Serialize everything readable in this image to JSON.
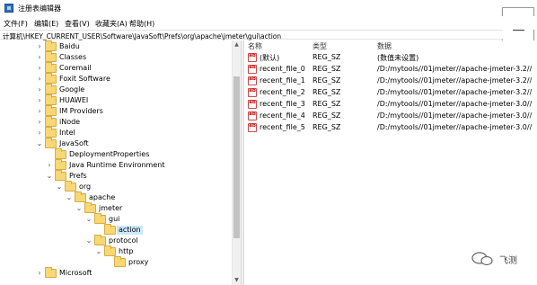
{
  "window": {
    "title": "注册表编辑器"
  },
  "menu": [
    "文件(F)",
    "编辑(E)",
    "查看(V)",
    "收藏夹(A)",
    "帮助(H)"
  ],
  "address": "计算机\\HKEY_CURRENT_USER\\Software\\JavaSoft\\Prefs\\org\\apache\\jmeter\\gui\\action",
  "tree": [
    {
      "label": "Baidu",
      "depth": 0,
      "state": "collapsed"
    },
    {
      "label": "Classes",
      "depth": 0,
      "state": "collapsed"
    },
    {
      "label": "Coremail",
      "depth": 0,
      "state": "collapsed"
    },
    {
      "label": "Foxit Software",
      "depth": 0,
      "state": "collapsed"
    },
    {
      "label": "Google",
      "depth": 0,
      "state": "collapsed"
    },
    {
      "label": "HUAWEI",
      "depth": 0,
      "state": "collapsed"
    },
    {
      "label": "IM Providers",
      "depth": 0,
      "state": "collapsed"
    },
    {
      "label": "iNode",
      "depth": 0,
      "state": "collapsed"
    },
    {
      "label": "Intel",
      "depth": 0,
      "state": "collapsed"
    },
    {
      "label": "JavaSoft",
      "depth": 0,
      "state": "expanded"
    },
    {
      "label": "DeploymentProperties",
      "depth": 1,
      "state": "none"
    },
    {
      "label": "Java Runtime Environment",
      "depth": 1,
      "state": "collapsed"
    },
    {
      "label": "Prefs",
      "depth": 1,
      "state": "expanded"
    },
    {
      "label": "org",
      "depth": 2,
      "state": "expanded"
    },
    {
      "label": "apache",
      "depth": 3,
      "state": "expanded"
    },
    {
      "label": "jmeter",
      "depth": 4,
      "state": "expanded"
    },
    {
      "label": "gui",
      "depth": 5,
      "state": "expanded"
    },
    {
      "label": "action",
      "depth": 6,
      "state": "none",
      "selected": true
    },
    {
      "label": "protocol",
      "depth": 5,
      "state": "expanded"
    },
    {
      "label": "http",
      "depth": 6,
      "state": "expanded"
    },
    {
      "label": "proxy",
      "depth": 7,
      "state": "none"
    },
    {
      "label": "Microsoft",
      "depth": 0,
      "state": "collapsed"
    }
  ],
  "list": {
    "columns": [
      "名称",
      "类型",
      "数据"
    ],
    "rows": [
      {
        "name": "(默认)",
        "type": "REG_SZ",
        "data": "(数值未设置)"
      },
      {
        "name": "recent_file_0",
        "type": "REG_SZ",
        "data": "/D:/mytools//01jmeter//apache-jmeter-3.2//"
      },
      {
        "name": "recent_file_1",
        "type": "REG_SZ",
        "data": "/D:/mytools//01jmeter//apache-jmeter-3.2//"
      },
      {
        "name": "recent_file_2",
        "type": "REG_SZ",
        "data": "/D:/mytools//01jmeter//apache-jmeter-3.2//"
      },
      {
        "name": "recent_file_3",
        "type": "REG_SZ",
        "data": "/D:/mytools//01jmeter//apache-jmeter-3.0//"
      },
      {
        "name": "recent_file_4",
        "type": "REG_SZ",
        "data": "/D:/mytools//01jmeter//apache-jmeter-3.0//"
      },
      {
        "name": "recent_file_5",
        "type": "REG_SZ",
        "data": "/D:/mytools//01jmeter//apache-jmeter-3.0//"
      }
    ]
  },
  "watermark": {
    "text": "飞测"
  },
  "colors": {
    "selection": "#cce8ff",
    "folder": "#f8d775",
    "accent": "#2f6fb3"
  }
}
